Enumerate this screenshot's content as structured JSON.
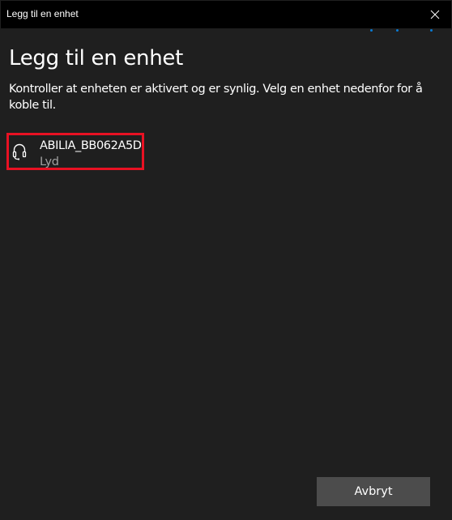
{
  "window": {
    "title": "Legg til en enhet",
    "close_icon": "close-icon"
  },
  "dialog": {
    "heading": "Legg til en enhet",
    "description": "Kontroller at enheten er aktivert og er synlig. Velg en enhet nedenfor for å koble til."
  },
  "devices": [
    {
      "name": "ABILIA_BB062A5D",
      "type": "Lyd",
      "icon": "headset-icon"
    }
  ],
  "footer": {
    "cancel_label": "Avbryt"
  },
  "colors": {
    "background": "#1f1f1f",
    "titlebar": "#000000",
    "accent": "#0a7bd4",
    "highlight_border": "#e81123",
    "button": "#4c4c4c",
    "secondary_text": "#a0a0a0"
  }
}
